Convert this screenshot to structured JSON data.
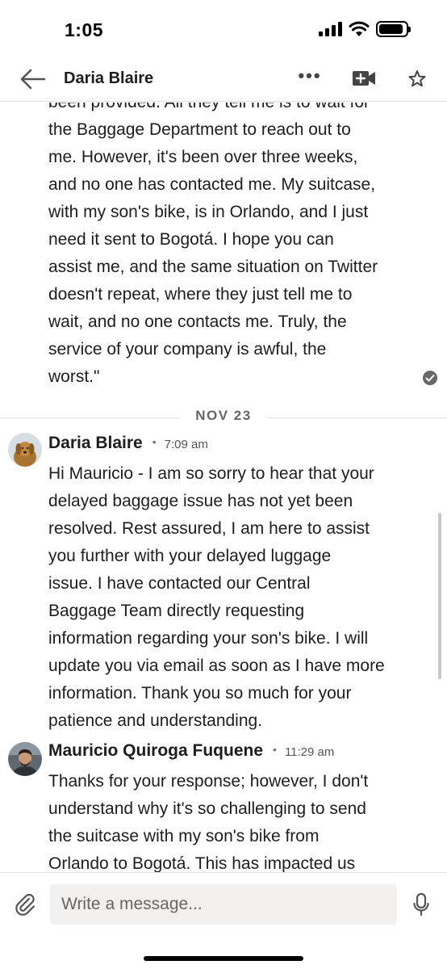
{
  "status_bar": {
    "time": "1:05",
    "battery_level": 0.9
  },
  "header": {
    "title": "Daria Blaire",
    "icons": {
      "back": "back-arrow-icon",
      "more": "more-icon",
      "video": "video-call-icon",
      "star": "star-icon"
    },
    "more_glyph": "•••"
  },
  "conversation": {
    "continued_message": "been provided. All they tell me is to wait for\nthe Baggage Department to reach out to\nme. However, it's been over three weeks,\nand no one has contacted me. My suitcase,\nwith my son's bike, is in Orlando, and I just\nneed it sent to Bogotá. I hope you can\nassist me, and the same situation on Twitter\ndoesn't repeat, where they just tell me to\nwait, and no one contacts me. Truly, the\nservice of your company is awful, the\nworst.\"",
    "date_divider": "NOV 23",
    "messages": [
      {
        "sender": "Daria Blaire",
        "separator": "•",
        "time": "7:09 am",
        "text": "Hi Mauricio - I am so sorry to hear that your\ndelayed baggage issue has not yet been\nresolved. Rest assured, I am here to assist\nyou further with your delayed luggage\nissue. I have contacted our Central\nBaggage Team directly requesting\ninformation regarding your son's bike. I will\nupdate you via email as soon as I have more\ninformation. Thank you so much for your\npatience and understanding."
      },
      {
        "sender": "Mauricio Quiroga Fuquene",
        "separator": "•",
        "time": "11:29 am",
        "text": "Thanks for your response; however, I don't\nunderstand why it's so challenging to send\nthe suitcase with my son's bike from\nOrlando to Bogotá. This has impacted us"
      }
    ]
  },
  "composer": {
    "placeholder": "Write a message..."
  },
  "colors": {
    "text": "#1d1d1d",
    "muted": "#666666",
    "divider": "#e2e2e2",
    "input_bg": "#f1f0ee"
  }
}
